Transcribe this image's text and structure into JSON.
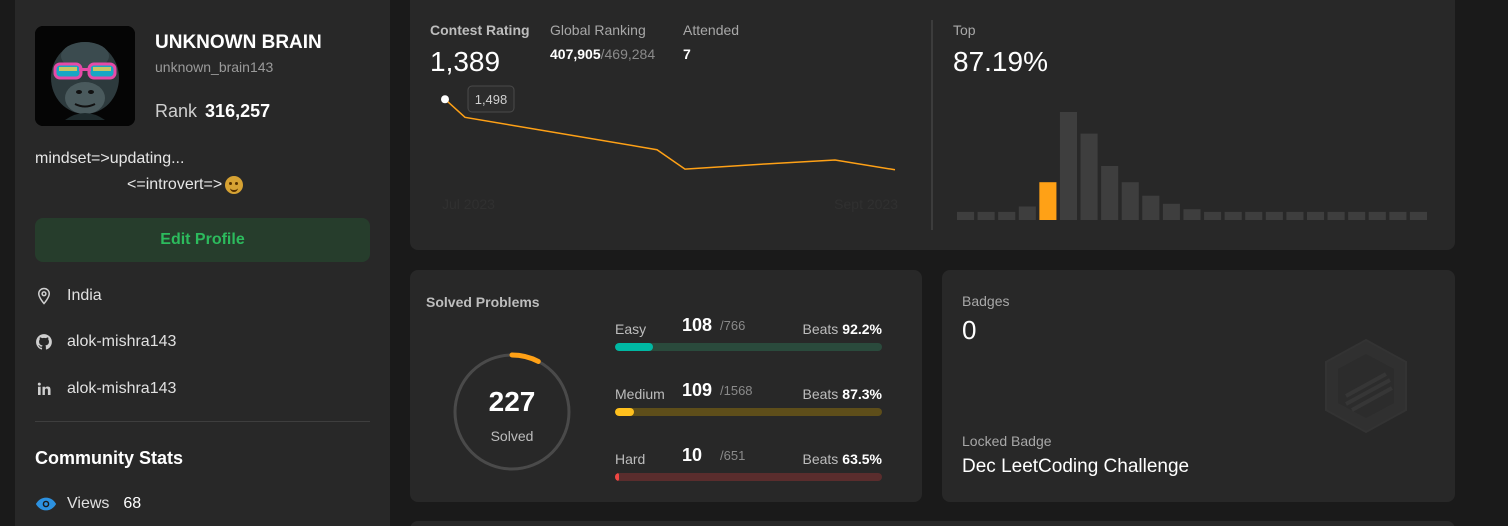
{
  "profile": {
    "name": "UNKNOWN BRAIN",
    "username": "unknown_brain143",
    "rank_label": "Rank",
    "rank_value": "316,257",
    "bio_line1": "mindset=>updating...",
    "bio_line2": "<=introvert=>",
    "edit_label": "Edit Profile",
    "location": "India",
    "github": "alok-mishra143",
    "linkedin": "alok-mishra143",
    "community_title": "Community Stats",
    "views_label": "Views",
    "views_value": "68"
  },
  "contest": {
    "rating_label": "Contest Rating",
    "rating_value": "1,389",
    "global_label": "Global Ranking",
    "global_value": "407,905",
    "global_total": "/469,284",
    "attended_label": "Attended",
    "attended_value": "7",
    "top_label": "Top",
    "top_value": "87.19%"
  },
  "chart_data": [
    {
      "type": "line",
      "x": [
        "Jul 2023",
        "",
        "",
        "",
        "",
        "",
        "Sept 2023"
      ],
      "x_tick_labels": [
        "Jul 2023",
        "Sept 2023"
      ],
      "values": [
        1498,
        1470,
        1420,
        1390,
        1398,
        1404,
        1389
      ],
      "tooltip": "1,498",
      "color": "#ffa116"
    },
    {
      "type": "bar",
      "values": [
        3,
        3,
        3,
        5,
        14,
        40,
        32,
        20,
        14,
        9,
        6,
        4,
        3,
        3,
        3,
        3,
        3,
        3,
        3,
        3,
        3,
        3,
        3
      ],
      "highlight_index": 4,
      "highlight_color": "#ffa116",
      "bar_color": "#3e3e3e"
    }
  ],
  "solved": {
    "title": "Solved Problems",
    "count": "227",
    "label": "Solved",
    "fraction": 0.0763,
    "items": [
      {
        "name": "Easy",
        "count": "108",
        "total": "/766",
        "beats_label": "Beats",
        "beats": "92.2%",
        "fraction": 0.141,
        "color": "#00b8a3",
        "track": "#2a4a3c"
      },
      {
        "name": "Medium",
        "count": "109",
        "total": "/1568",
        "beats_label": "Beats",
        "beats": "87.3%",
        "fraction": 0.0695,
        "color": "#ffc01e",
        "track": "#5e4e1a"
      },
      {
        "name": "Hard",
        "count": "10",
        "total": "/651",
        "beats_label": "Beats",
        "beats": "63.5%",
        "fraction": 0.0154,
        "color": "#ef4743",
        "track": "#5a2d2d"
      }
    ]
  },
  "badges": {
    "label": "Badges",
    "value": "0",
    "locked_label": "Locked Badge",
    "locked_name": "Dec LeetCoding Challenge"
  }
}
